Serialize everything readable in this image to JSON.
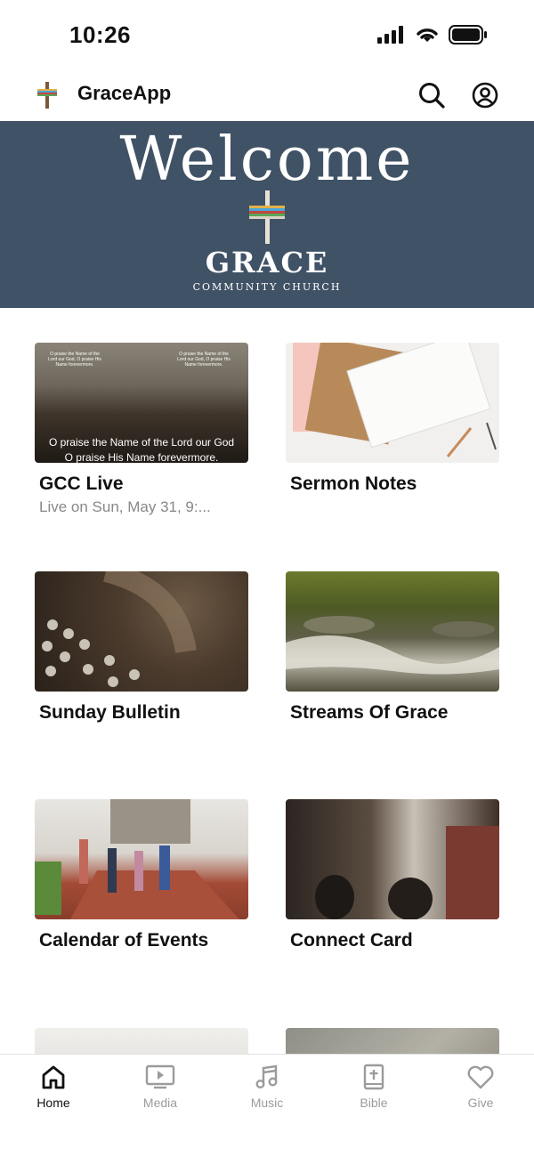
{
  "status_bar": {
    "time": "10:26"
  },
  "header": {
    "title": "GraceApp"
  },
  "banner": {
    "welcome": "Welcome",
    "name": "GRACE",
    "subtitle": "COMMUNITY CHURCH"
  },
  "cards": [
    {
      "title": "GCC Live",
      "subtitle": "Live on Sun, May 31, 9:...",
      "lyric_line1": "O praise the Name of the Lord our God",
      "lyric_line2": "O praise His Name forevermore.",
      "slide_text": "O praise the Name of the Lord our God, O praise His Name forevermore."
    },
    {
      "title": "Sermon Notes"
    },
    {
      "title": "Sunday Bulletin"
    },
    {
      "title": "Streams Of Grace"
    },
    {
      "title": "Calendar of Events"
    },
    {
      "title": "Connect Card"
    },
    {
      "title": ""
    },
    {
      "title": ""
    }
  ],
  "tabs": [
    {
      "label": "Home",
      "icon": "home-icon",
      "active": true
    },
    {
      "label": "Media",
      "icon": "media-icon"
    },
    {
      "label": "Music",
      "icon": "music-icon"
    },
    {
      "label": "Bible",
      "icon": "bible-icon"
    },
    {
      "label": "Give",
      "icon": "heart-icon"
    }
  ],
  "colors": {
    "banner_bg": "#405266",
    "active_tab": "#111111",
    "inactive_tab": "#9b9b9b"
  }
}
